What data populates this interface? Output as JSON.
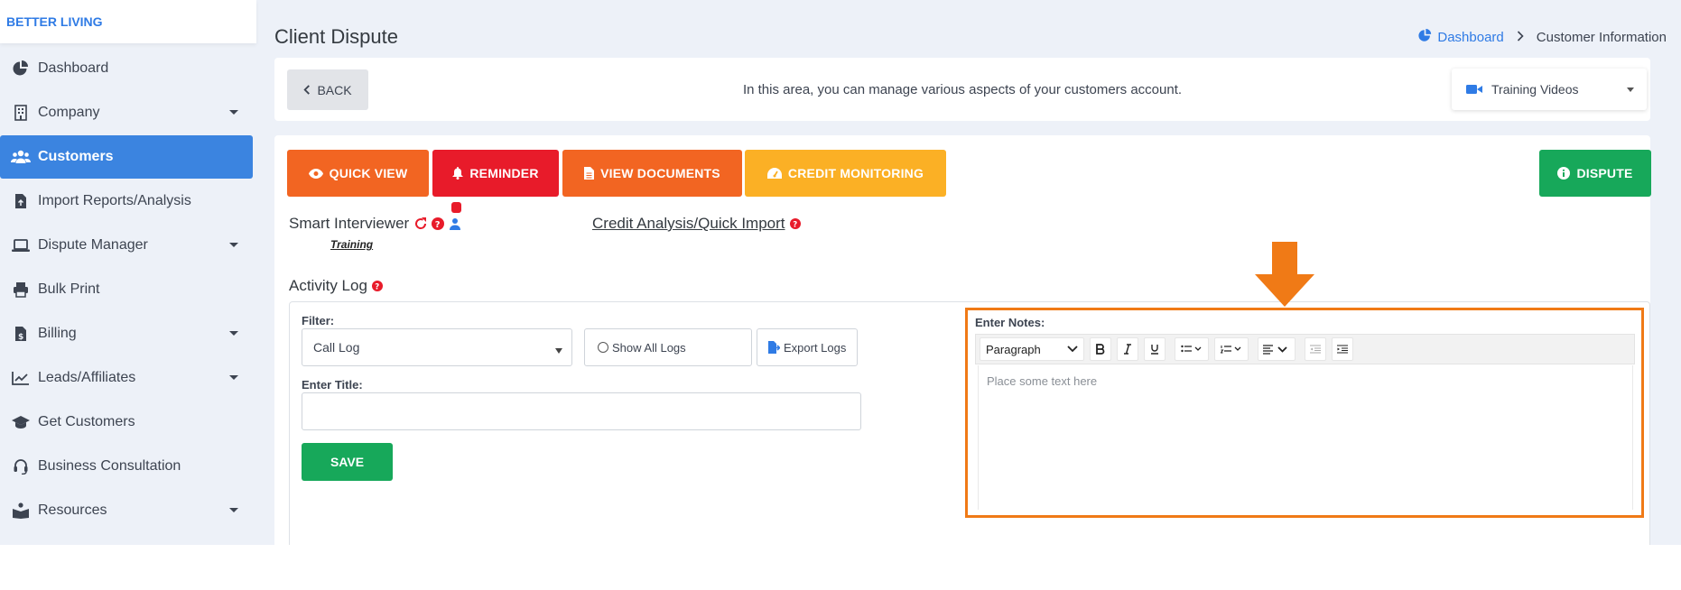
{
  "brand": "BETTER LIVING",
  "sidebar": {
    "items": [
      {
        "label": "Dashboard",
        "icon": "dashboard-pie-icon",
        "dropdown": false
      },
      {
        "label": "Company",
        "icon": "building-icon",
        "dropdown": true
      },
      {
        "label": "Customers",
        "icon": "users-icon",
        "dropdown": false,
        "active": true
      },
      {
        "label": "Import Reports/Analysis",
        "icon": "file-import-icon",
        "dropdown": false
      },
      {
        "label": "Dispute Manager",
        "icon": "laptop-icon",
        "dropdown": true
      },
      {
        "label": "Bulk Print",
        "icon": "printer-icon",
        "dropdown": false
      },
      {
        "label": "Billing",
        "icon": "invoice-dollar-icon",
        "dropdown": true
      },
      {
        "label": "Leads/Affiliates",
        "icon": "chart-line-icon",
        "dropdown": true
      },
      {
        "label": "Get Customers",
        "icon": "graduation-cap-icon",
        "dropdown": false
      },
      {
        "label": "Business Consultation",
        "icon": "headset-icon",
        "dropdown": false
      },
      {
        "label": "Resources",
        "icon": "book-reader-icon",
        "dropdown": true
      }
    ]
  },
  "header": {
    "title": "Client Dispute",
    "breadcrumb": {
      "home": "Dashboard",
      "current": "Customer Information"
    }
  },
  "top_card": {
    "back_label": "BACK",
    "info": "In this area, you can manage various aspects of your customers account.",
    "training_select": "Training Videos"
  },
  "actions": {
    "quick_view": "QUICK VIEW",
    "reminder": "REMINDER",
    "view_documents": "VIEW DOCUMENTS",
    "credit_monitoring": "CREDIT MONITORING",
    "dispute": "DISPUTE"
  },
  "colors": {
    "quick_view": "#f26522",
    "reminder": "#e81b2a",
    "view_documents": "#f26522",
    "credit_monitoring": "#fbb025",
    "dispute": "#17a85a",
    "accent": "#3b84e0",
    "highlight": "#f07a16"
  },
  "smart_interviewer": {
    "label": "Smart Interviewer",
    "training": "Training"
  },
  "credit_analysis": "Credit Analysis/Quick Import",
  "activity_log": {
    "title": "Activity Log",
    "filter_label": "Filter:",
    "filter_value": "Call Log",
    "show_all": "Show All Logs",
    "export": "Export Logs",
    "title_label": "Enter Title:",
    "title_value": "",
    "save": "SAVE"
  },
  "notes": {
    "label": "Enter Notes:",
    "paragraph": "Paragraph",
    "placeholder": "Place some text here"
  }
}
